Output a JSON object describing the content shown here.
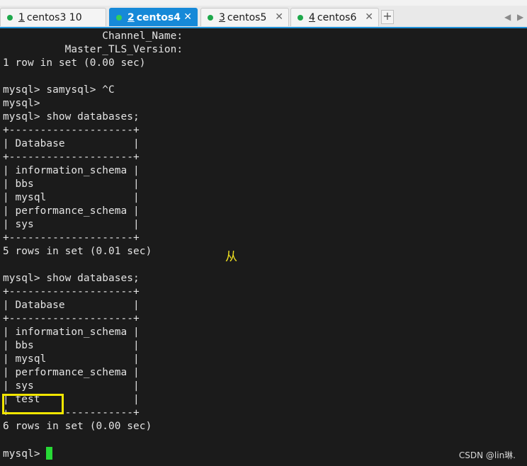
{
  "tabs": [
    {
      "num": "1",
      "label": "centos3  10",
      "active": false
    },
    {
      "num": "2",
      "label": "centos4",
      "active": true
    },
    {
      "num": "3",
      "label": "centos5",
      "active": false
    },
    {
      "num": "4",
      "label": "centos6",
      "active": false
    }
  ],
  "tab_close_glyph": "✕",
  "add_tab_glyph": "+",
  "nav": {
    "prev": "◀",
    "next": "▶"
  },
  "terminal_lines": [
    "                Channel_Name: ",
    "          Master_TLS_Version: ",
    "1 row in set (0.00 sec)",
    "",
    "mysql> samysql> ^C",
    "mysql> ",
    "mysql> show databases;",
    "+--------------------+",
    "| Database           |",
    "+--------------------+",
    "| information_schema |",
    "| bbs                |",
    "| mysql              |",
    "| performance_schema |",
    "| sys                |",
    "+--------------------+",
    "5 rows in set (0.01 sec)",
    "",
    "mysql> show databases;",
    "+--------------------+",
    "| Database           |",
    "+--------------------+",
    "| information_schema |",
    "| bbs                |",
    "| mysql              |",
    "| performance_schema |",
    "| sys                |",
    "| test               |",
    "+--------------------+",
    "6 rows in set (0.00 sec)",
    ""
  ],
  "prompt": "mysql> ",
  "annotation": "从",
  "watermark": "CSDN @lin琳."
}
